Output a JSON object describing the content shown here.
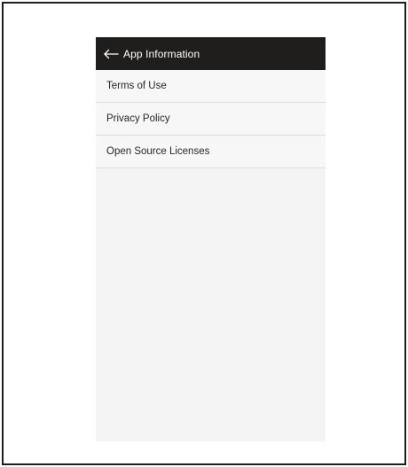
{
  "appbar": {
    "back_icon": "arrow-left-icon",
    "title": "App Information"
  },
  "menu": {
    "items": [
      {
        "label": "Terms of Use"
      },
      {
        "label": "Privacy Policy"
      },
      {
        "label": "Open Source Licenses"
      }
    ]
  },
  "colors": {
    "appbar_bg": "#201d1d",
    "screen_bg": "#f4f4f4",
    "divider": "#dcdcdc",
    "text": "#262626"
  }
}
